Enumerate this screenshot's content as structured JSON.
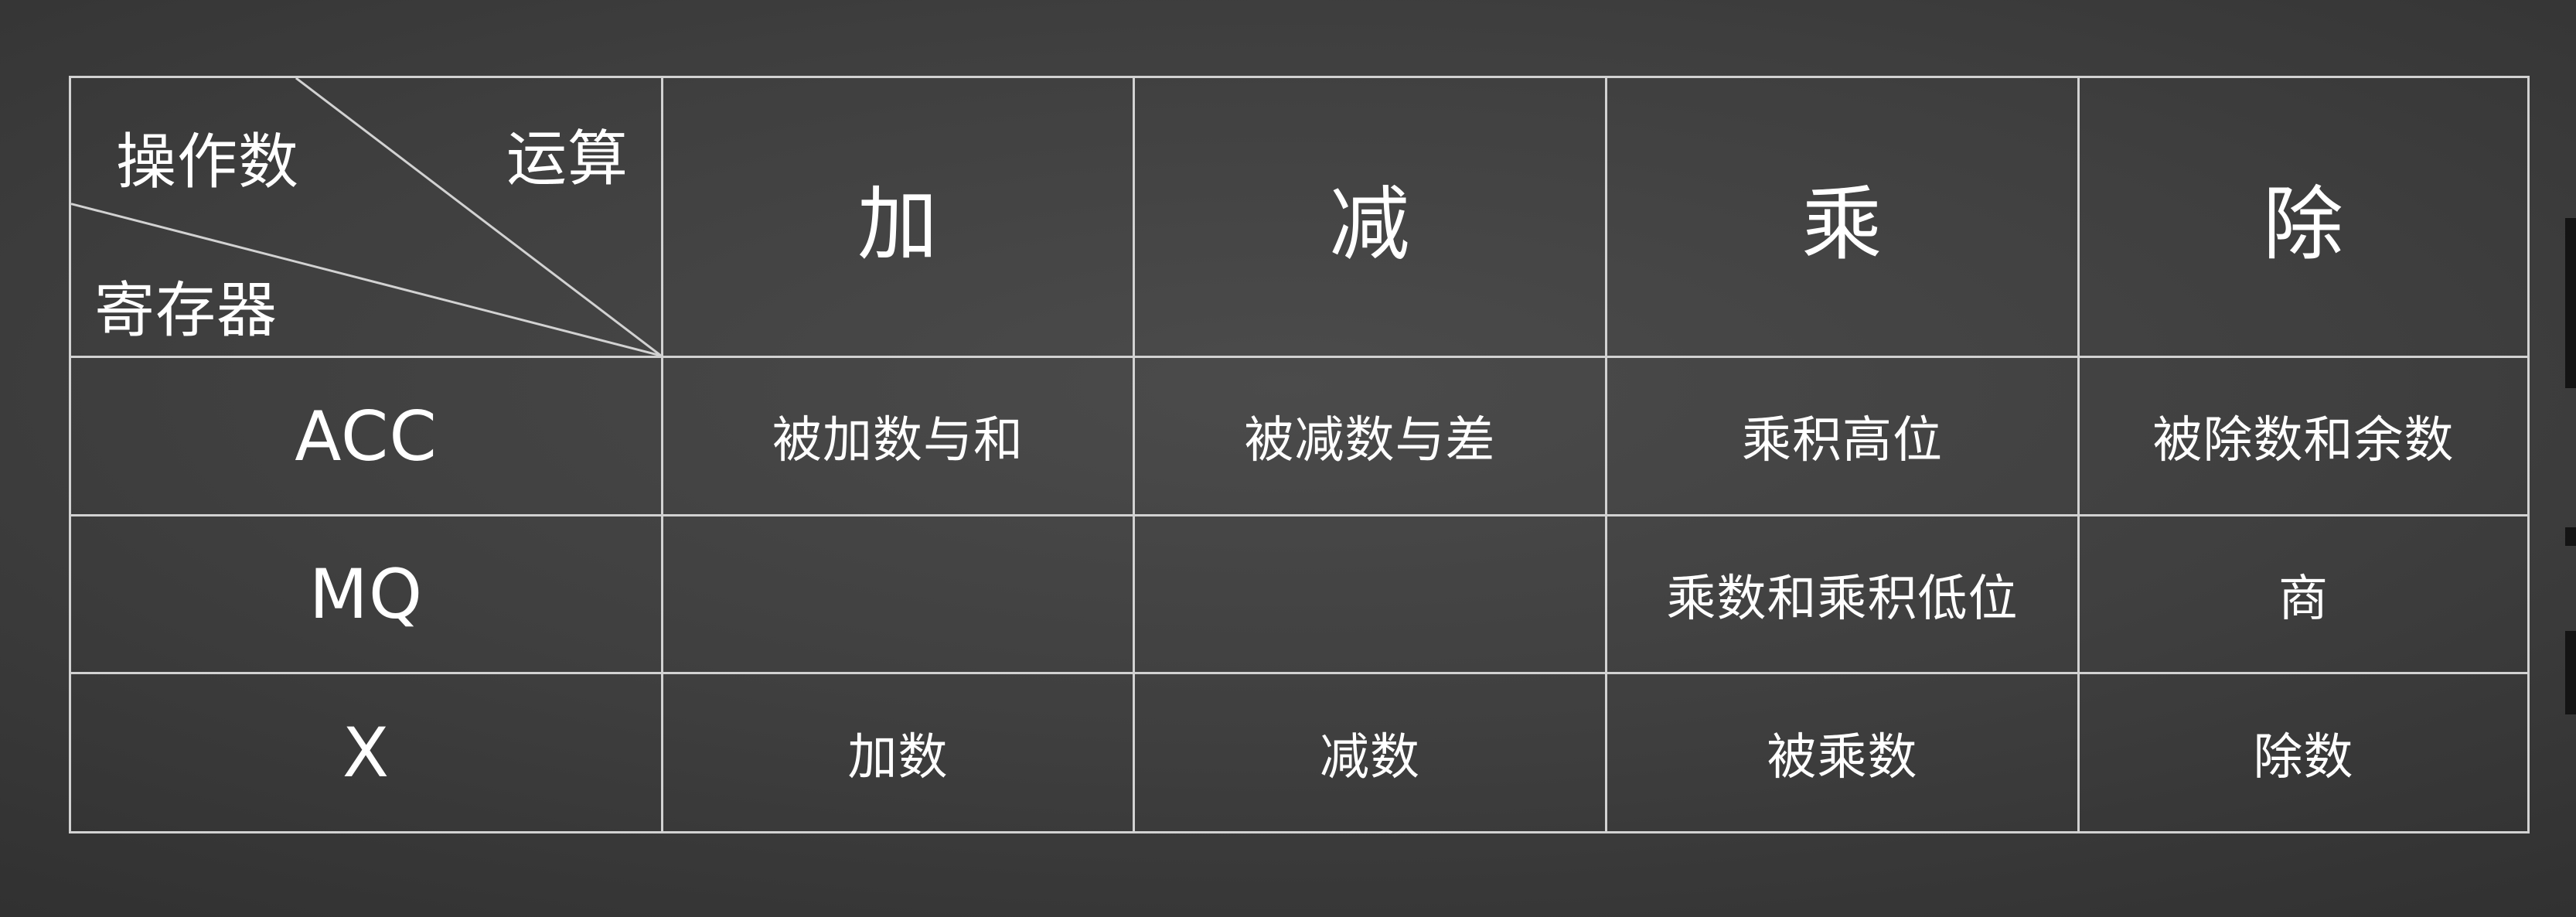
{
  "table": {
    "corner": {
      "operand_label": "操作数",
      "operation_label": "运算",
      "register_label": "寄存器"
    },
    "operation_headers": [
      "加",
      "减",
      "乘",
      "除"
    ],
    "rows": [
      {
        "register": "ACC",
        "cells": [
          "被加数与和",
          "被减数与差",
          "乘积高位",
          "被除数和余数"
        ]
      },
      {
        "register": "MQ",
        "cells": [
          "",
          "",
          "乘数和乘积低位",
          "商"
        ]
      },
      {
        "register": "X",
        "cells": [
          "加数",
          "减数",
          "被乘数",
          "除数"
        ]
      }
    ]
  },
  "colors": {
    "background": "#3f3f3f",
    "text": "#ffffff",
    "grid_line": "#d2d2d2"
  }
}
